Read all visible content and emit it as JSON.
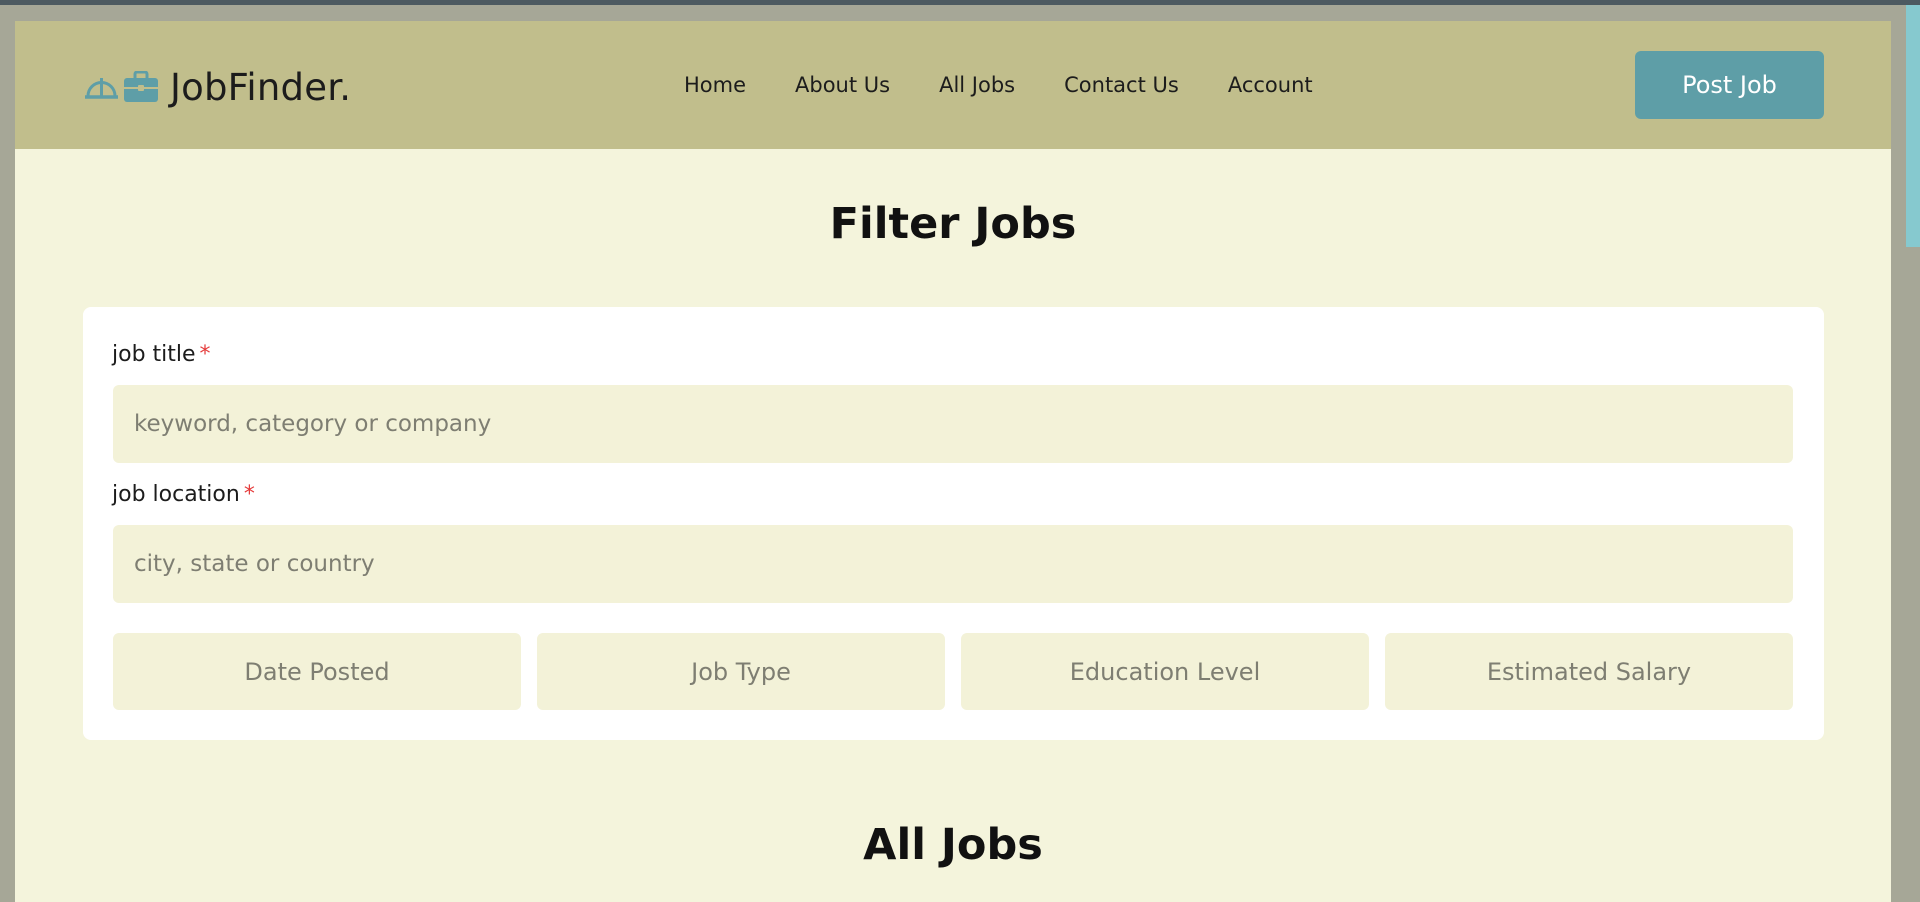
{
  "brand": {
    "name": "JobFinder.",
    "accent": "#5e9ea7"
  },
  "nav": {
    "items": [
      {
        "label": "Home"
      },
      {
        "label": "About Us"
      },
      {
        "label": "All Jobs"
      },
      {
        "label": "Contact Us"
      },
      {
        "label": "Account"
      }
    ]
  },
  "header": {
    "post_job_label": "Post Job"
  },
  "filter": {
    "title": "Filter Jobs",
    "job_title": {
      "label": "job title",
      "required": "*",
      "placeholder": "keyword, category or company",
      "value": ""
    },
    "job_location": {
      "label": "job location",
      "required": "*",
      "placeholder": "city, state or country",
      "value": ""
    },
    "selects": [
      {
        "label": "Date Posted"
      },
      {
        "label": "Job Type"
      },
      {
        "label": "Education Level"
      },
      {
        "label": "Estimated Salary"
      }
    ]
  },
  "all_jobs": {
    "title": "All Jobs"
  },
  "icons": [
    "hard-hat-icon",
    "briefcase-icon"
  ],
  "colors": {
    "header_bg": "#c1be8c",
    "page_bg": "#f4f4dc",
    "required": "#e53b3b"
  }
}
